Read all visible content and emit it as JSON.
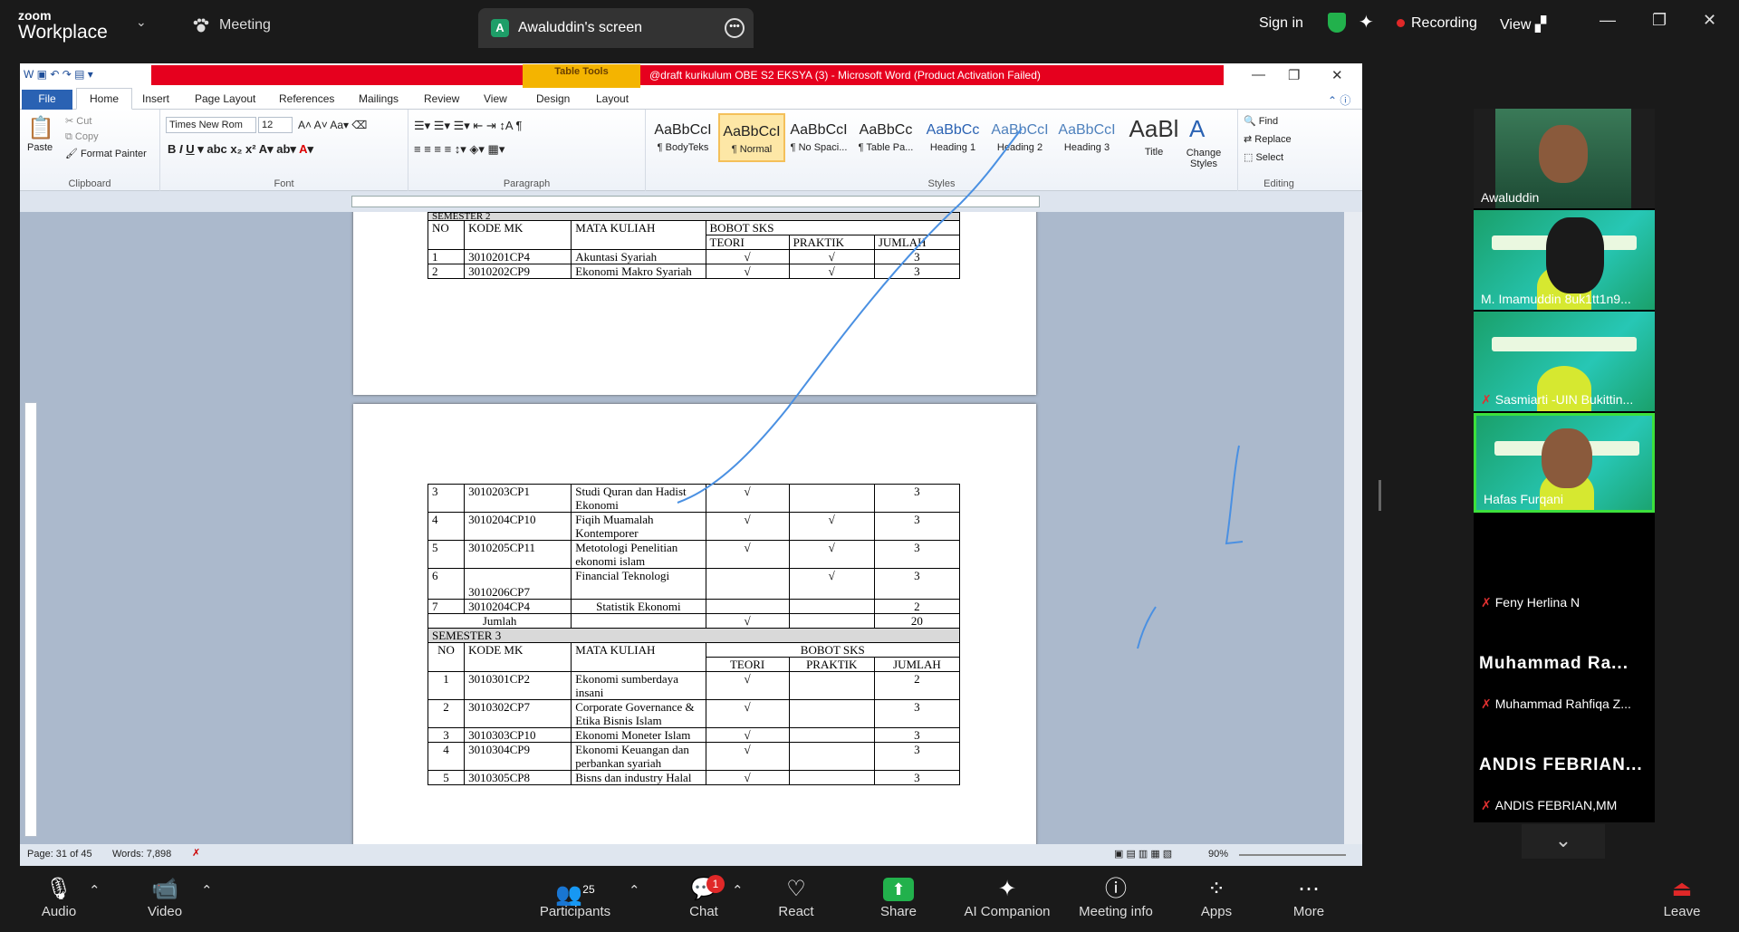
{
  "zoom": {
    "brand_top": "zoom",
    "brand_bottom": "Workplace",
    "meeting_label": "Meeting",
    "screen_tab": {
      "avatar_letter": "A",
      "label": "Awaluddin's screen"
    },
    "sign_in": "Sign in",
    "recording": "Recording",
    "view": "View",
    "accent_green": "#22b14c",
    "record_red": "#e02828"
  },
  "word": {
    "window_title": "@draft kurikulum OBE S2 EKSYA (3)  -  Microsoft Word (Product Activation Failed)",
    "table_tools": "Table Tools",
    "tabs": [
      "File",
      "Home",
      "Insert",
      "Page Layout",
      "References",
      "Mailings",
      "Review",
      "View",
      "Design",
      "Layout"
    ],
    "clipboard": {
      "paste": "Paste",
      "cut": "Cut",
      "copy": "Copy",
      "format_painter": "Format Painter",
      "label": "Clipboard"
    },
    "font": {
      "name": "Times New Rom",
      "size": "12",
      "label": "Font"
    },
    "paragraph_label": "Paragraph",
    "styles": [
      {
        "sample": "AaBbCcI",
        "name": "¶ BodyTeks"
      },
      {
        "sample": "AaBbCcI",
        "name": "¶ Normal"
      },
      {
        "sample": "AaBbCcI",
        "name": "¶ No Spaci..."
      },
      {
        "sample": "AaBbCc",
        "name": "¶ Table Pa..."
      },
      {
        "sample": "AaBbCc",
        "name": "Heading 1"
      },
      {
        "sample": "AaBbCcI",
        "name": "Heading 2"
      },
      {
        "sample": "AaBbCcI",
        "name": "Heading 3"
      },
      {
        "sample": "AaBl",
        "name": "Title"
      }
    ],
    "change_styles": "Change Styles",
    "styles_label": "Styles",
    "editing": {
      "find": "Find",
      "replace": "Replace",
      "select": "Select",
      "label": "Editing"
    },
    "status": {
      "page": "Page: 31 of 45",
      "words": "Words: 7,898",
      "zoom": "90%"
    }
  },
  "doc": {
    "sem2_partial": "SEMESTER 2",
    "headers": {
      "no": "NO",
      "kode": "KODE MK",
      "mata": "MATA KULIAH",
      "bobot": "BOBOT SKS",
      "teori": "TEORI",
      "praktik": "PRAKTIK",
      "jumlah": "JUMLAH"
    },
    "check": "√",
    "page1_rows": [
      {
        "no": "1",
        "kode": "3010201CP4",
        "mata": "Akuntasi Syariah",
        "teori": "√",
        "praktik": "√",
        "jumlah": "3"
      },
      {
        "no": "2",
        "kode": "3010202CP9",
        "mata": "Ekonomi Makro Syariah",
        "teori": "√",
        "praktik": "√",
        "jumlah": "3"
      }
    ],
    "page2_rows": [
      {
        "no": "3",
        "kode": "3010203CP1",
        "mata": "Studi Quran dan Hadist Ekonomi",
        "teori": "√",
        "praktik": "",
        "jumlah": "3"
      },
      {
        "no": "4",
        "kode": "3010204CP10",
        "mata": "Fiqih Muamalah Kontemporer",
        "teori": "√",
        "praktik": "√",
        "jumlah": "3"
      },
      {
        "no": "5",
        "kode": "3010205CP11",
        "mata": "Metotologi Penelitian ekonomi islam",
        "teori": "√",
        "praktik": "√",
        "jumlah": "3"
      },
      {
        "no": "6",
        "kode": "3010206CP7",
        "mata": "Financial Teknologi",
        "teori": "",
        "praktik": "√",
        "jumlah": "3"
      },
      {
        "no": "7",
        "kode": "3010204CP4",
        "mata": "Statistik Ekonomi",
        "teori": "",
        "praktik": "",
        "jumlah": "2"
      }
    ],
    "jumlah_row": {
      "label": "Jumlah",
      "teori": "√",
      "jumlah": "20"
    },
    "sem3": "SEMESTER 3",
    "sem3_rows": [
      {
        "no": "1",
        "kode": "3010301CP2",
        "mata": "Ekonomi sumberdaya insani",
        "teori": "√",
        "praktik": "",
        "jumlah": "2"
      },
      {
        "no": "2",
        "kode": "3010302CP7",
        "mata": "Corporate Governance & Etika Bisnis Islam",
        "teori": "√",
        "praktik": "",
        "jumlah": "3"
      },
      {
        "no": "3",
        "kode": "3010303CP10",
        "mata": "Ekonomi Moneter Islam",
        "teori": "√",
        "praktik": "",
        "jumlah": "3"
      },
      {
        "no": "4",
        "kode": "3010304CP9",
        "mata": "Ekonomi Keuangan dan perbankan syariah",
        "teori": "√",
        "praktik": "",
        "jumlah": "3"
      },
      {
        "no": "5",
        "kode": "3010305CP8",
        "mata": "Bisns dan industry Halal",
        "teori": "√",
        "praktik": "",
        "jumlah": "3"
      }
    ]
  },
  "participants_panel": [
    {
      "name": "Awaluddin",
      "kind": "video",
      "muted": false
    },
    {
      "name": "M. Imamuddin 8uk1tt1n9...",
      "kind": "banner",
      "muted": false
    },
    {
      "name": "Sasmiarti -UIN Bukittin...",
      "kind": "banner",
      "muted": true
    },
    {
      "name": "Hafas Furqani",
      "kind": "banner-video",
      "muted": false
    },
    {
      "name": "Feny Herlina N",
      "kind": "blank",
      "muted": true
    },
    {
      "name": "Muhammad Rahfiqa Z...",
      "big": "Muhammad  Ra...",
      "kind": "text",
      "muted": true
    },
    {
      "name": "ANDIS FEBRIAN,MM",
      "big": "ANDIS  FEBRIAN...",
      "kind": "text",
      "muted": true
    }
  ],
  "toolbar": {
    "audio": "Audio",
    "video": "Video",
    "participants": "Participants",
    "participants_count": "25",
    "chat": "Chat",
    "chat_badge": "1",
    "react": "React",
    "share": "Share",
    "ai": "AI Companion",
    "info": "Meeting info",
    "apps": "Apps",
    "more": "More",
    "leave": "Leave"
  }
}
